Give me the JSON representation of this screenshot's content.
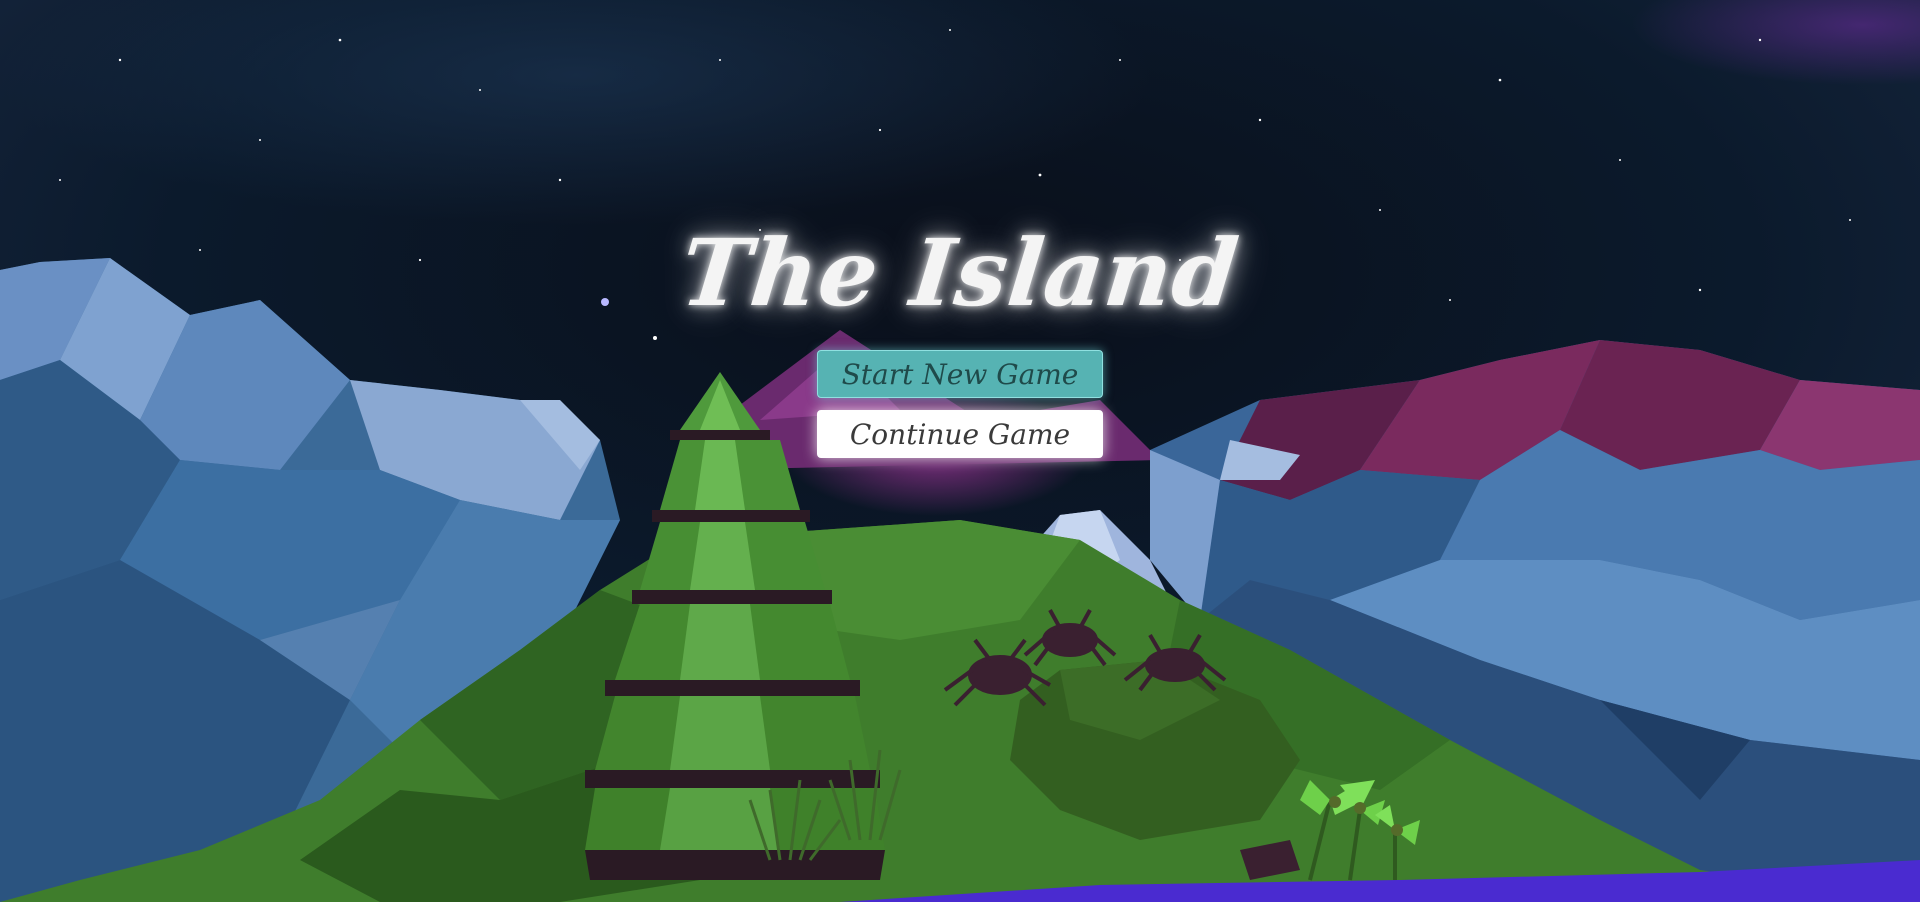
{
  "game": {
    "title": "The Island"
  },
  "menu": {
    "start_label": "Start New Game",
    "continue_label": "Continue Game",
    "selected": "Start New Game"
  },
  "colors": {
    "start_button": "#56b3b3",
    "continue_button": "#ffffff",
    "sky": "#05070c",
    "mountain_blue": "#3f6e9c",
    "mountain_magenta": "#6e1f4e",
    "grass": "#3f7d2c",
    "water": "#4a2bd0"
  }
}
